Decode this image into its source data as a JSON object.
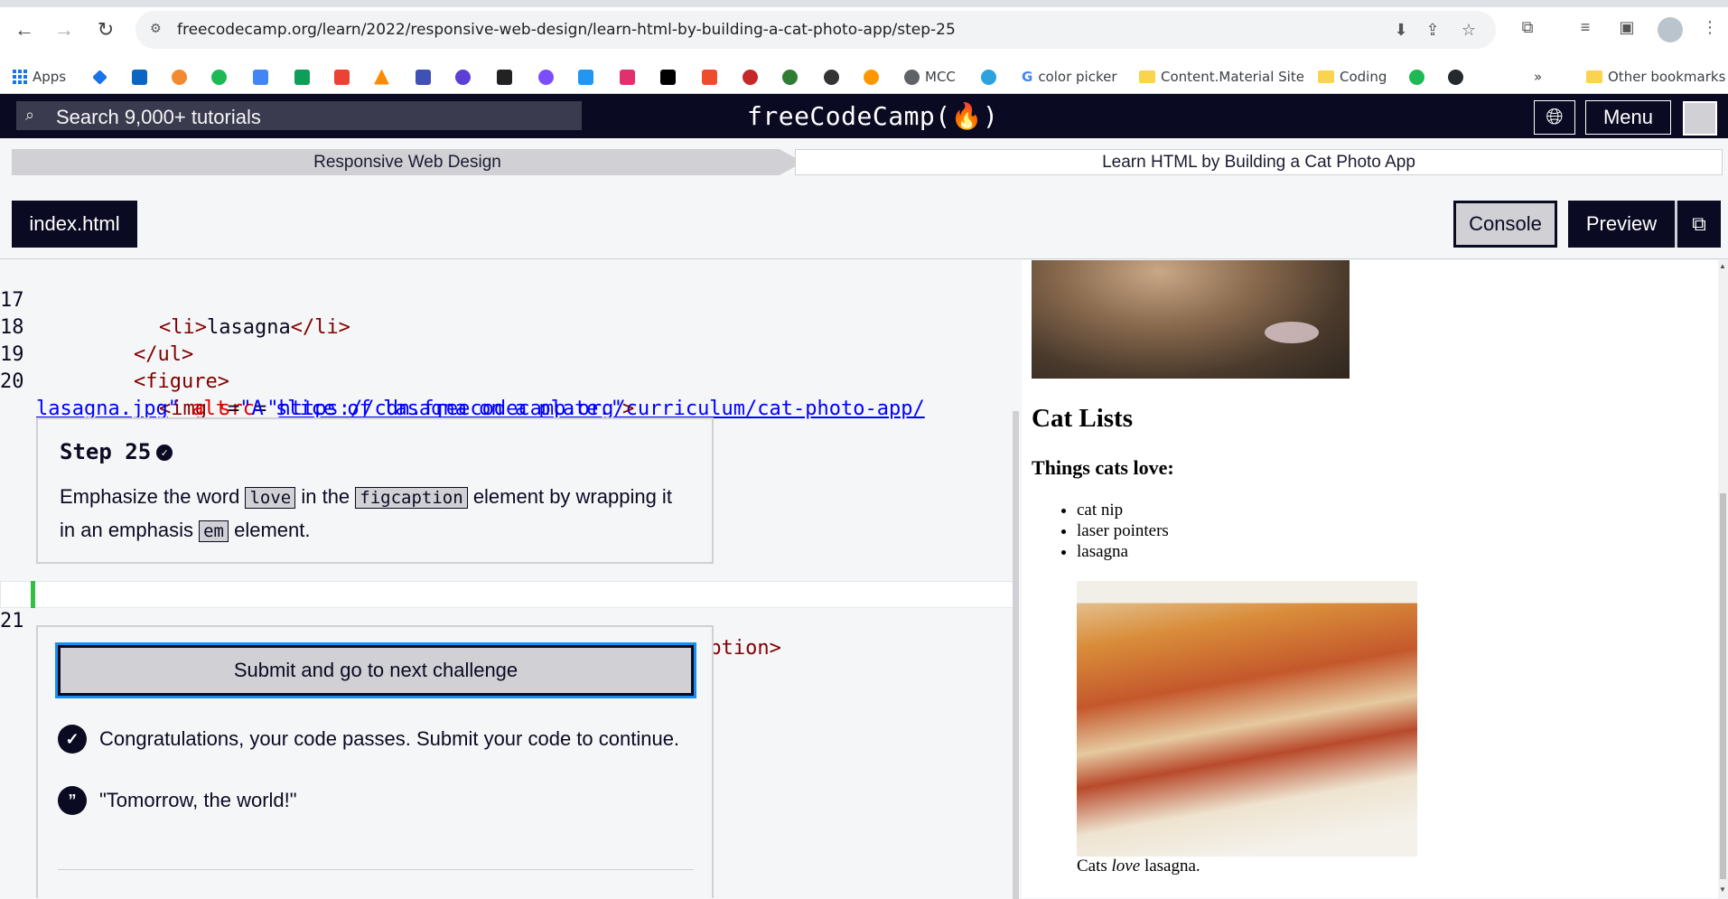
{
  "browser": {
    "url": "freecodecamp.org/learn/2022/responsive-web-design/learn-html-by-building-a-cat-photo-app/step-25",
    "bookmarks": [
      "Apps",
      "MCC",
      "color picker",
      "Content.Material Site",
      "Coding",
      "Other bookmarks"
    ],
    "more_label": "»"
  },
  "fcc": {
    "search_placeholder": "Search 9,000+ tutorials",
    "logo": "freeCodeCamp(🔥)",
    "menu_label": "Menu",
    "breadcrumb_left": "Responsive Web Design",
    "breadcrumb_right": "Learn HTML by Building a Cat Photo App",
    "file_tab": "index.html",
    "console_label": "Console",
    "preview_label": "Preview"
  },
  "editor": {
    "lines": [
      {
        "num": "17",
        "text": "<li>lasagna</li>"
      },
      {
        "num": "18",
        "text": "</ul>"
      },
      {
        "num": "19",
        "text": "<figure>"
      },
      {
        "num": "20",
        "text": "<img src=\"https://cdn.freecodecamp.org/curriculum/cat-photo-app/lasagna.jpg\" alt=\"A slice of lasagna on a plate.\">"
      },
      {
        "num": "21",
        "text": "<figcaption>Cats <em>love</em> lasagna.</figcaption>"
      }
    ],
    "step_title": "Step 25",
    "step_desc_1": "Emphasize the word",
    "step_code_1": "love",
    "step_desc_2": "in the",
    "step_code_2": "figcaption",
    "step_desc_3": "element by wrapping it in an emphasis",
    "step_code_3": "em",
    "step_desc_4": "element.",
    "submit_label": "Submit and go to next challenge",
    "success_message": "Congratulations, your code passes. Submit your code to continue.",
    "quote": "\"Tomorrow, the world!\""
  },
  "preview": {
    "heading": "Cat Lists",
    "subheading": "Things cats love:",
    "items": [
      "cat nip",
      "laser pointers",
      "lasagna"
    ],
    "figcaption_before": "Cats ",
    "figcaption_em": "love",
    "figcaption_after": " lasagna."
  },
  "colors": {
    "fcc_dark": "#0a0a23",
    "fcc_gray": "#d0d0d5",
    "tag": "#800000",
    "attr": "#e50000",
    "string": "#0000ff",
    "focus_blue": "#198eee",
    "gutter_green": "#31bf46"
  }
}
